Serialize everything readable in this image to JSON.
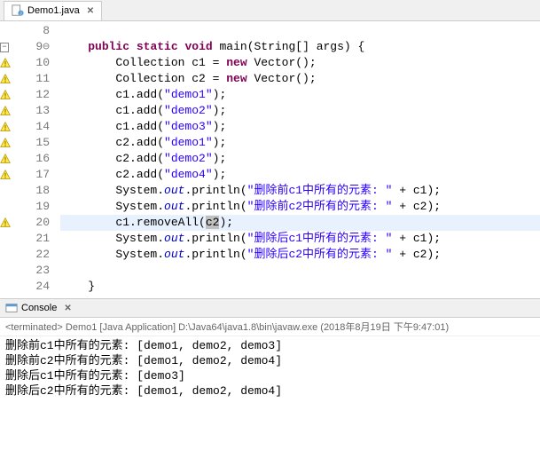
{
  "tab": {
    "filename": "Demo1.java"
  },
  "lines": [
    {
      "n": 8,
      "ann": "",
      "html": ""
    },
    {
      "n": 9,
      "ann": "fold",
      "html": "    <span class='kw'>public</span> <span class='kw'>static</span> <span class='kw'>void</span> main(String[] args) {"
    },
    {
      "n": 10,
      "ann": "w",
      "html": "        Collection c1 = <span class='kw'>new</span> Vector();"
    },
    {
      "n": 11,
      "ann": "w",
      "html": "        Collection c2 = <span class='kw'>new</span> Vector();"
    },
    {
      "n": 12,
      "ann": "w",
      "html": "        c1.add(<span class='str'>\"demo1\"</span>);"
    },
    {
      "n": 13,
      "ann": "w",
      "html": "        c1.add(<span class='str'>\"demo2\"</span>);"
    },
    {
      "n": 14,
      "ann": "w",
      "html": "        c1.add(<span class='str'>\"demo3\"</span>);"
    },
    {
      "n": 15,
      "ann": "w",
      "html": "        c2.add(<span class='str'>\"demo1\"</span>);"
    },
    {
      "n": 16,
      "ann": "w",
      "html": "        c2.add(<span class='str'>\"demo2\"</span>);"
    },
    {
      "n": 17,
      "ann": "w",
      "html": "        c2.add(<span class='str'>\"demo4\"</span>);"
    },
    {
      "n": 18,
      "ann": "",
      "html": "        System.<span class='fld'>out</span>.println(<span class='str'>\"删除前c1中所有的元素: \"</span> + c1);"
    },
    {
      "n": 19,
      "ann": "",
      "html": "        System.<span class='fld'>out</span>.println(<span class='str'>\"删除前c2中所有的元素: \"</span> + c2);"
    },
    {
      "n": 20,
      "ann": "w",
      "hl": true,
      "html": "        c1.removeAll(<span class='cur'>c2</span>);"
    },
    {
      "n": 21,
      "ann": "",
      "html": "        System.<span class='fld'>out</span>.println(<span class='str'>\"删除后c1中所有的元素: \"</span> + c1);"
    },
    {
      "n": 22,
      "ann": "",
      "html": "        System.<span class='fld'>out</span>.println(<span class='str'>\"删除后c2中所有的元素: \"</span> + c2);"
    },
    {
      "n": 23,
      "ann": "",
      "html": ""
    },
    {
      "n": 24,
      "ann": "",
      "html": "    }"
    }
  ],
  "console": {
    "title": "Console",
    "header_prefix": "<terminated>",
    "header_main": " Demo1 [Java Application] D:\\Java64\\java1.8\\bin\\javaw.exe (2018年8月19日 下午9:47:01)",
    "output": [
      "删除前c1中所有的元素: [demo1, demo2, demo3]",
      "删除前c2中所有的元素: [demo1, demo2, demo4]",
      "删除后c1中所有的元素: [demo3]",
      "删除后c2中所有的元素: [demo1, demo2, demo4]"
    ]
  }
}
